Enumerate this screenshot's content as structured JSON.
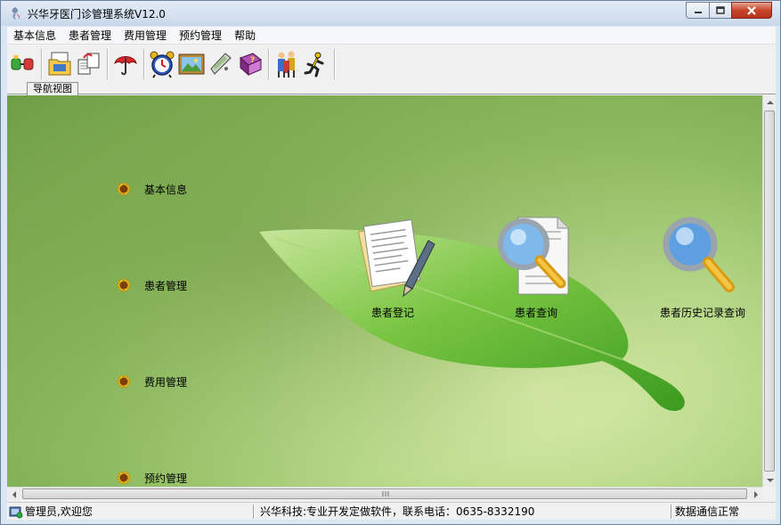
{
  "window": {
    "title": "兴华牙医门诊管理系统V12.0"
  },
  "menu": {
    "items": [
      "基本信息",
      "患者管理",
      "费用管理",
      "预约管理",
      "帮助"
    ]
  },
  "toolbar": {
    "icons": [
      "link-icon",
      "folder-icon",
      "documents-icon",
      "umbrella-icon",
      "alarm-clock-icon",
      "picture-icon",
      "pda-icon",
      "help-book-icon",
      "users-icon",
      "running-man-icon"
    ]
  },
  "tabs": {
    "nav_label": "导航视图"
  },
  "nav": {
    "items": [
      "基本信息",
      "患者管理",
      "费用管理",
      "预约管理"
    ]
  },
  "functions": {
    "register_label": "患者登记",
    "query_label": "患者查询",
    "history_label": "患者历史记录查询"
  },
  "status": {
    "user_text": "管理员,欢迎您",
    "company_text": "兴华科技:专业开发定做软件，联系电话：0635-8332190",
    "connection_text": "数据通信正常"
  },
  "colors": {
    "background_green": "#8fbc60",
    "leaf_green": "#4fae2a",
    "close_button": "#c7452b"
  }
}
